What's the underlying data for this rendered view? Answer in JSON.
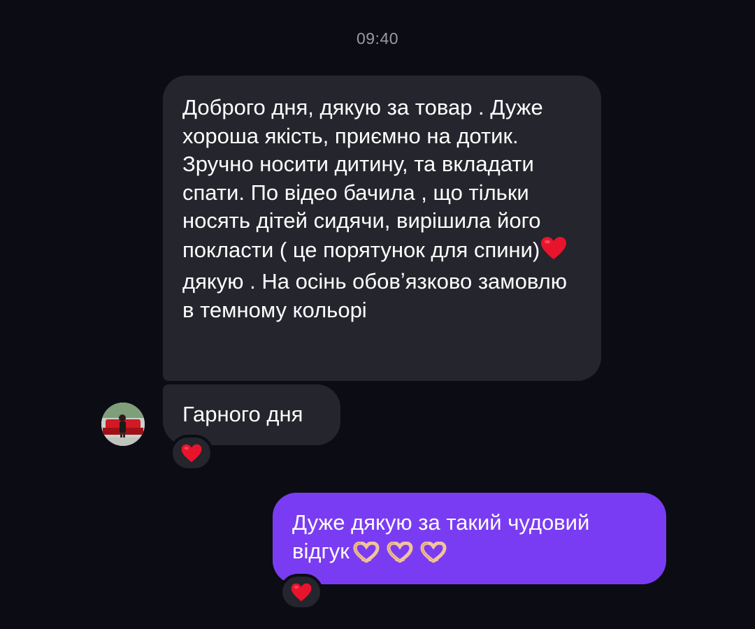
{
  "chat": {
    "timestamp": "09:40",
    "messages": [
      {
        "direction": "incoming",
        "text_part1": "Доброго дня, дякую за товар . Дуже хороша якість, приємно на дотик. Зручно носити дитину, та вкладати спати. По відео бачила , що тільки носять дітей сидячи, вирішила його покласти ( це порятунок для спини)",
        "text_part2": " дякую . На осінь обовʼязково замовлю в темному кольорі",
        "inline_icon": "red-heart-emoji"
      },
      {
        "direction": "incoming",
        "text": "Гарного дня",
        "reaction": "red-heart-emoji"
      },
      {
        "direction": "outgoing",
        "text": "Дуже дякую за такий чудовий відгук",
        "trailing_icons": [
          "heart-hands-emoji",
          "heart-hands-emoji",
          "heart-hands-emoji"
        ],
        "reaction": "red-heart-emoji"
      }
    ]
  },
  "colors": {
    "background": "#0c0c14",
    "incoming_bubble": "#25252d",
    "outgoing_bubble": "#7a3cf2",
    "timestamp": "#9a9aa2",
    "heart": "#e8142c"
  },
  "avatar": {
    "icon": "contact-avatar-photo"
  }
}
